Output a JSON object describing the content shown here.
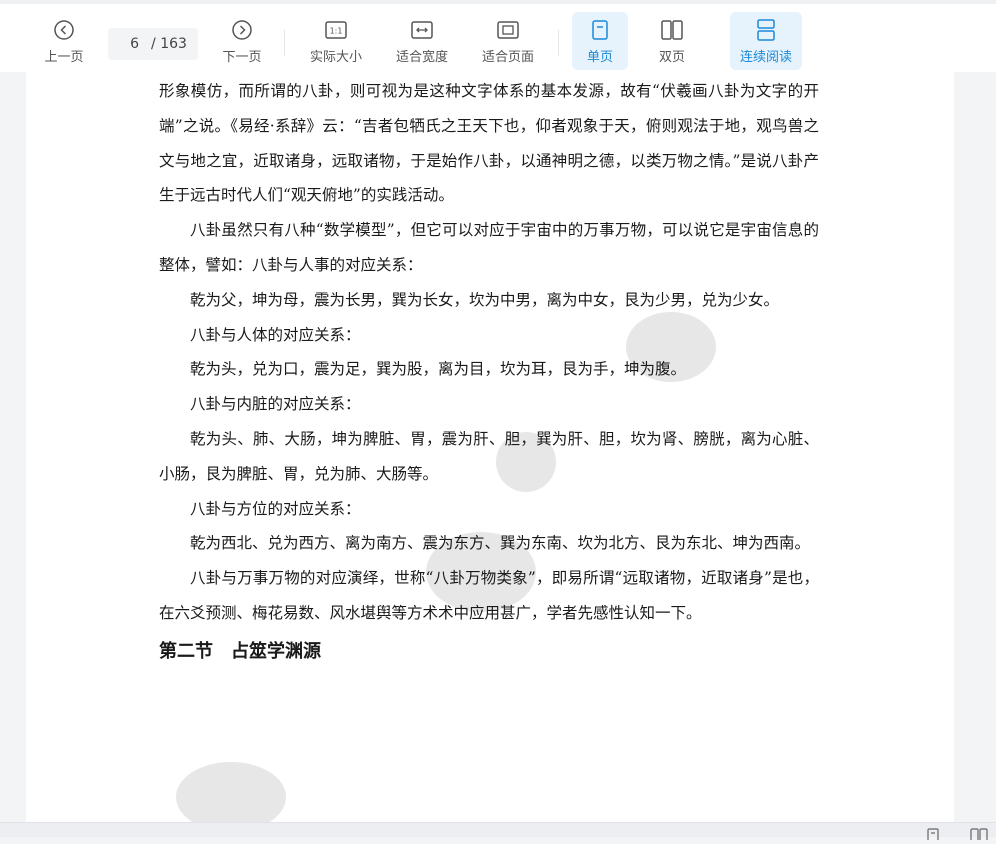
{
  "toolbar": {
    "prev_label": "上一页",
    "current_page": "6",
    "total_pages": "/ 163",
    "next_label": "下一页",
    "actual_size_label": "实际大小",
    "actual_size_glyph": "1:1",
    "fit_width_label": "适合宽度",
    "fit_page_label": "适合页面",
    "single_label": "单页",
    "double_label": "双页",
    "continuous_label": "连续阅读",
    "accent_color": "#1a8ad6"
  },
  "document": {
    "paragraphs": [
      {
        "text": "形象模仿，而所谓的八卦，则可视为是这种文字体系的基本发源，故有“伏羲画八卦为文字的开端”之说。《易经·系辞》云：“吉者包牺氏之王天下也，仰者观象于天，俯则观法于地，观鸟兽之文与地之宜，近取诸身，远取诸物，于是始作八卦，以通神明之德，以类万物之情。”是说八卦产生于远古时代人们“观天俯地”的实践活动。",
        "indent": false
      },
      {
        "text": "八卦虽然只有八种“数学模型”，但它可以对应于宇宙中的万事万物，可以说它是宇宙信息的整体，譬如：八卦与人事的对应关系：",
        "indent": true
      },
      {
        "text": "乾为父，坤为母，震为长男，巽为长女，坎为中男，离为中女，艮为少男，兑为少女。",
        "indent": true
      },
      {
        "text": "八卦与人体的对应关系：",
        "indent": true
      },
      {
        "text": "乾为头，兑为口，震为足，巽为股，离为目，坎为耳，艮为手，坤为腹。",
        "indent": true
      },
      {
        "text": "八卦与内脏的对应关系：",
        "indent": true
      },
      {
        "text": "乾为头、肺、大肠，坤为脾脏、胃，震为肝、胆，巽为肝、胆，坎为肾、膀胱，离为心脏、小肠，艮为脾脏、胃，兑为肺、大肠等。",
        "indent": true
      },
      {
        "text": "八卦与方位的对应关系：",
        "indent": true
      },
      {
        "text": "乾为西北、兑为西方、离为南方、震为东方、巽为东南、坎为北方、艮为东北、坤为西南。",
        "indent": true
      },
      {
        "text": "八卦与万事万物的对应演绎，世称“八卦万物类象”，即易所谓“远取诸物，近取诸身”是也，在六爻预测、梅花易数、风水堪舆等方术术中应用甚广，学者先感性认知一下。",
        "indent": true
      }
    ],
    "section_heading": "第二节　占筮学渊源"
  }
}
